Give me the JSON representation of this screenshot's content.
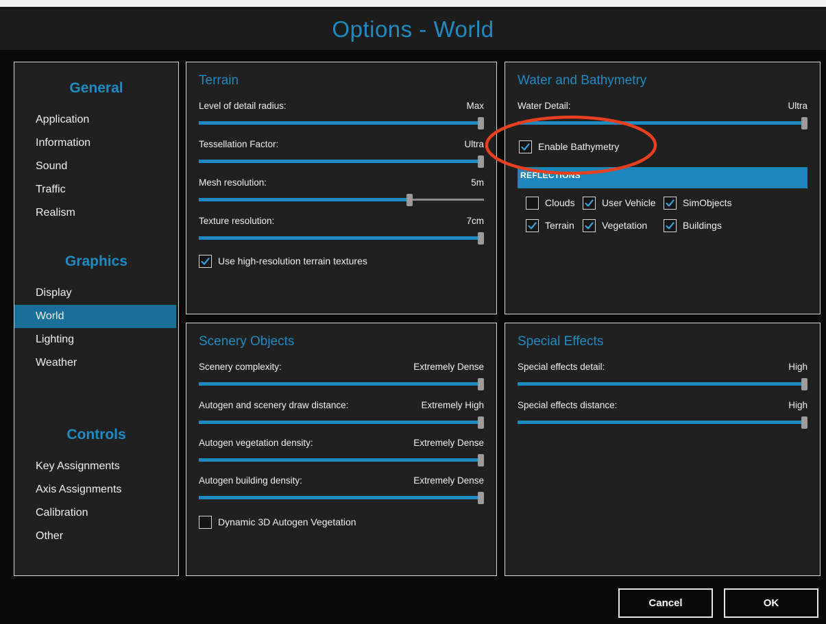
{
  "window": {
    "title": "Options - World"
  },
  "sidebar": {
    "sections": [
      {
        "heading": "General",
        "items": [
          "Application",
          "Information",
          "Sound",
          "Traffic",
          "Realism"
        ]
      },
      {
        "heading": "Graphics",
        "items": [
          "Display",
          "World",
          "Lighting",
          "Weather"
        ]
      },
      {
        "heading": "Controls",
        "items": [
          "Key Assignments",
          "Axis Assignments",
          "Calibration",
          "Other"
        ]
      }
    ],
    "active_item": "World"
  },
  "terrain": {
    "title": "Terrain",
    "settings": [
      {
        "label": "Level of detail radius:",
        "value": "Max",
        "level": 1.0
      },
      {
        "label": "Tessellation Factor:",
        "value": "Ultra",
        "level": 1.0
      },
      {
        "label": "Mesh resolution:",
        "value": "5m",
        "level": 0.75
      },
      {
        "label": "Texture resolution:",
        "value": "7cm",
        "level": 1.0
      }
    ],
    "checkbox": {
      "label": "Use high-resolution terrain textures",
      "checked": true
    }
  },
  "water": {
    "title": "Water and Bathymetry",
    "settings": [
      {
        "label": "Water Detail:",
        "value": "Ultra",
        "level": 1.0
      }
    ],
    "bathymetry": {
      "label": "Enable Bathymetry",
      "checked": true
    },
    "reflections_header": "REFLECTIONS",
    "reflections": [
      {
        "label": "Clouds",
        "checked": false
      },
      {
        "label": "User Vehicle",
        "checked": true
      },
      {
        "label": "SimObjects",
        "checked": true
      },
      {
        "label": "Terrain",
        "checked": true
      },
      {
        "label": "Vegetation",
        "checked": true
      },
      {
        "label": "Buildings",
        "checked": true
      }
    ]
  },
  "scenery": {
    "title": "Scenery Objects",
    "settings": [
      {
        "label": "Scenery complexity:",
        "value": "Extremely Dense",
        "level": 1.0
      },
      {
        "label": "Autogen and scenery draw distance:",
        "value": "Extremely High",
        "level": 1.0
      },
      {
        "label": "Autogen vegetation density:",
        "value": "Extremely Dense",
        "level": 1.0
      },
      {
        "label": "Autogen building density:",
        "value": "Extremely Dense",
        "level": 1.0
      }
    ],
    "checkbox": {
      "label": "Dynamic 3D Autogen Vegetation",
      "checked": false
    }
  },
  "effects": {
    "title": "Special Effects",
    "settings": [
      {
        "label": "Special effects detail:",
        "value": "High",
        "level": 1.0
      },
      {
        "label": "Special effects distance:",
        "value": "High",
        "level": 1.0
      }
    ]
  },
  "buttons": {
    "cancel": "Cancel",
    "ok": "OK"
  },
  "colors": {
    "accent": "#1e8bc3",
    "highlight_circle": "#e8401c",
    "panel": "#202020",
    "background": "#090909"
  }
}
